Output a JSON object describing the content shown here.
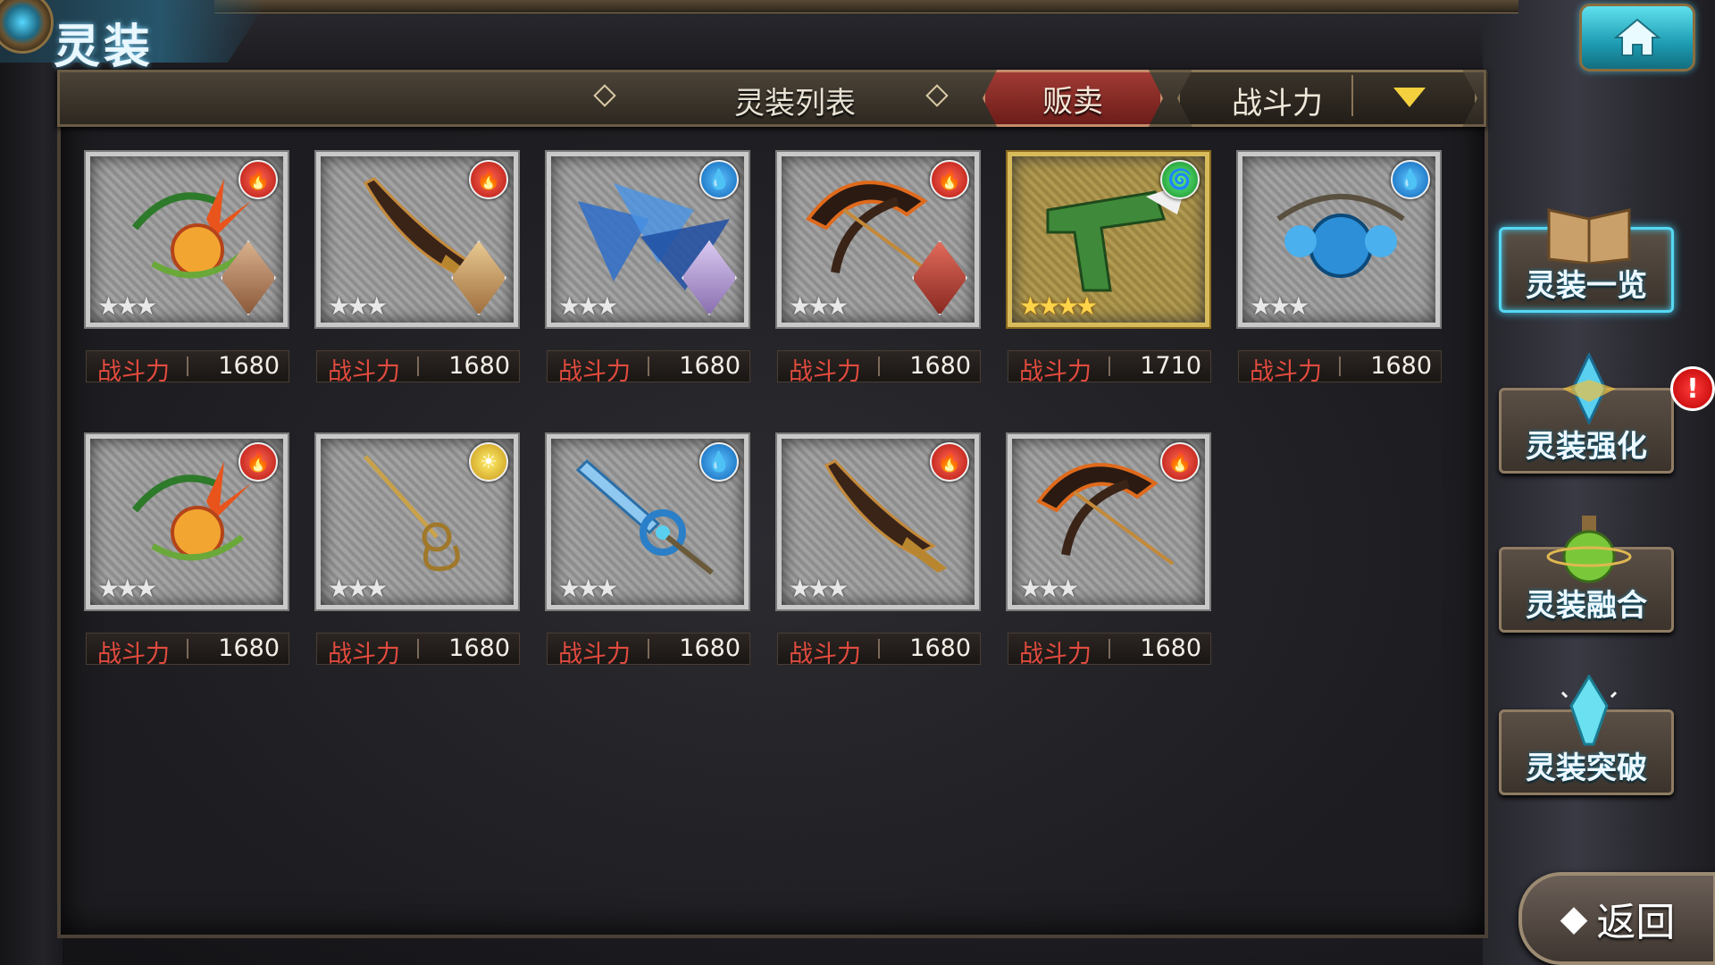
{
  "screen_title": "灵装",
  "header": {
    "list_title": "灵装列表",
    "sell_label": "贩卖",
    "sort_label": "战斗力"
  },
  "cards_row1": [
    {
      "element": "fire",
      "element_glyph": "🔥",
      "stars": "★★★",
      "power_label": "战斗力",
      "power": "1680",
      "weapon": "fire-flower-weapon",
      "portrait": true
    },
    {
      "element": "fire",
      "element_glyph": "🔥",
      "stars": "★★★",
      "power_label": "战斗力",
      "power": "1680",
      "weapon": "dark-blade",
      "portrait": true
    },
    {
      "element": "water",
      "element_glyph": "💧",
      "stars": "★★★",
      "power_label": "战斗力",
      "power": "1680",
      "weapon": "ice-crystal-claws",
      "portrait": true
    },
    {
      "element": "fire",
      "element_glyph": "🔥",
      "stars": "★★★",
      "power_label": "战斗力",
      "power": "1680",
      "weapon": "flame-crossbow",
      "portrait": true
    },
    {
      "element": "wind",
      "element_glyph": "🌀",
      "stars": "★★★★",
      "power_label": "战斗力",
      "power": "1710",
      "weapon": "green-gun",
      "portrait": false
    },
    {
      "element": "water",
      "element_glyph": "💧",
      "stars": "★★★",
      "power_label": "战斗力",
      "power": "1680",
      "weapon": "blue-rose-orb",
      "portrait": false
    }
  ],
  "cards_row2": [
    {
      "element": "fire",
      "element_glyph": "🔥",
      "stars": "★★★",
      "power_label": "战斗力",
      "power": "1680",
      "weapon": "fire-flower-weapon"
    },
    {
      "element": "light",
      "element_glyph": "☀",
      "stars": "★★★",
      "power_label": "战斗力",
      "power": "1680",
      "weapon": "golden-rapier"
    },
    {
      "element": "water",
      "element_glyph": "💧",
      "stars": "★★★",
      "power_label": "战斗力",
      "power": "1680",
      "weapon": "azure-sword"
    },
    {
      "element": "fire",
      "element_glyph": "🔥",
      "stars": "★★★",
      "power_label": "战斗力",
      "power": "1680",
      "weapon": "dark-blade"
    },
    {
      "element": "fire",
      "element_glyph": "🔥",
      "stars": "★★★",
      "power_label": "战斗力",
      "power": "1680",
      "weapon": "flame-crossbow"
    }
  ],
  "side_menu": [
    {
      "label": "灵装一览",
      "icon": "book-icon",
      "active": true
    },
    {
      "label": "灵装强化",
      "icon": "crystal-burst-icon",
      "active": false,
      "alert": "!"
    },
    {
      "label": "灵装融合",
      "icon": "potion-flask-icon",
      "active": false
    },
    {
      "label": "灵装突破",
      "icon": "crystal-shard-icon",
      "active": false
    }
  ],
  "back_label": "返回",
  "colors": {
    "accent_cyan": "#3fc4e4",
    "power_red": "#e24b3f",
    "sell_red": "#a03a33"
  }
}
